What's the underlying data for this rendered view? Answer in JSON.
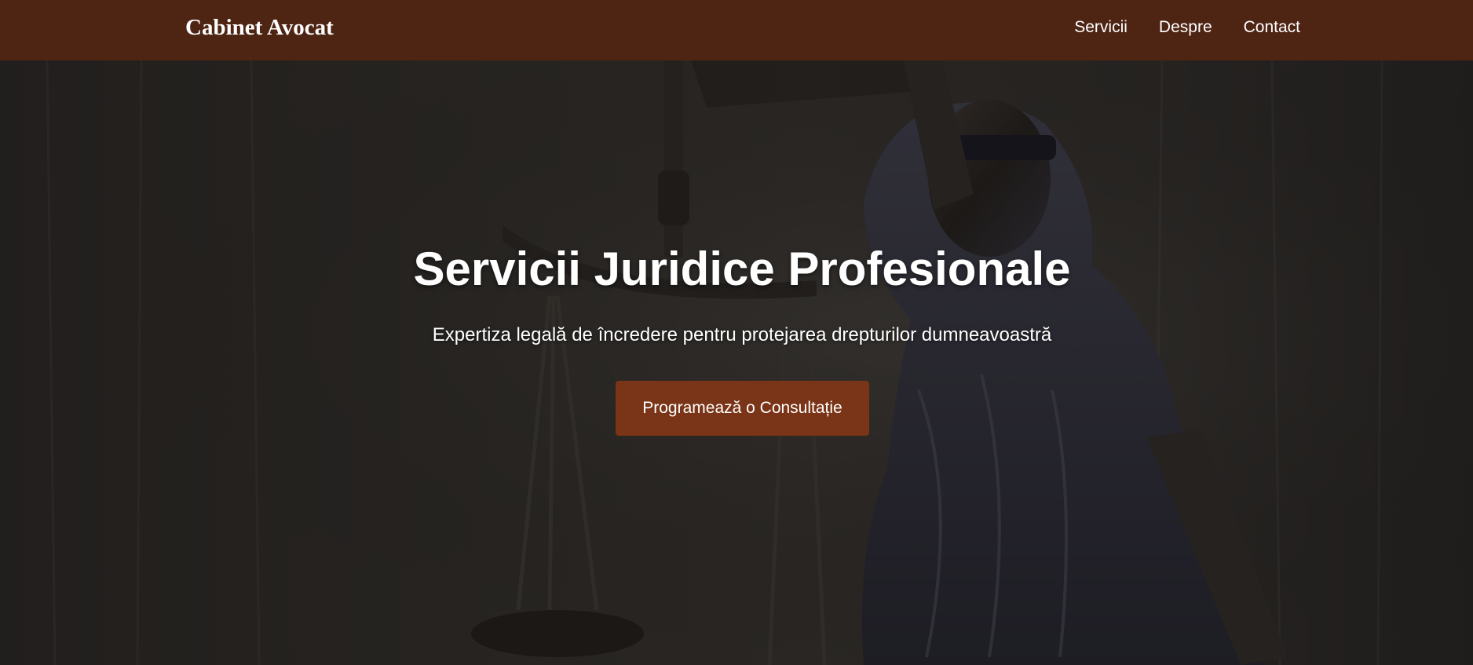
{
  "navbar": {
    "brand": "Cabinet Avocat",
    "links": [
      {
        "label": "Servicii"
      },
      {
        "label": "Despre"
      },
      {
        "label": "Contact"
      }
    ]
  },
  "hero": {
    "title": "Servicii Juridice Profesionale",
    "subtitle": "Expertiza legală de încredere pentru protejarea drepturilor dumneavoastră",
    "cta_label": "Programează o Consultație",
    "background_image": "lady-justice-statue-with-scales"
  },
  "colors": {
    "navbar_bg": "#4e2413",
    "cta_bg": "#7a3417",
    "text": "#ffffff"
  }
}
